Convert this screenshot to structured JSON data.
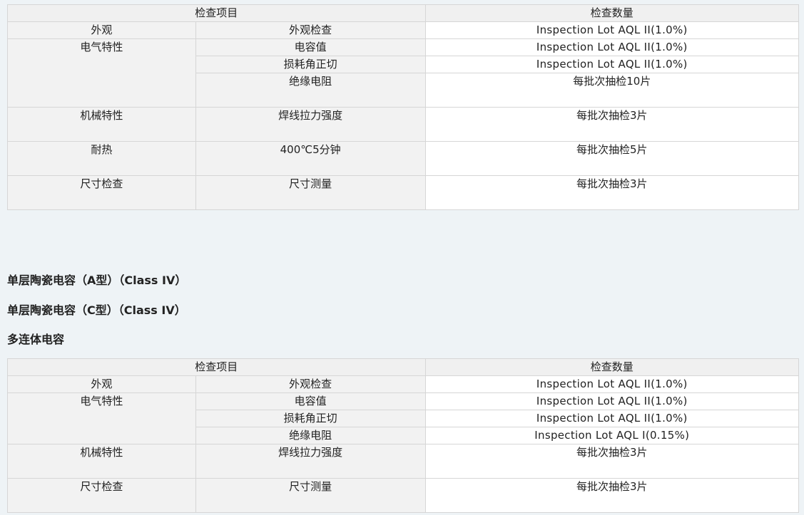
{
  "table1": {
    "header": {
      "item": "检查项目",
      "qty": "检查数量"
    },
    "rows": [
      {
        "cat": "外观",
        "sub": "外观检查",
        "qty": "Inspection Lot AQL II(1.0%)"
      },
      {
        "cat": "电气特性",
        "sub": "电容值",
        "qty": "Inspection Lot AQL II(1.0%)"
      },
      {
        "sub": "损耗角正切",
        "qty": "Inspection Lot AQL II(1.0%)"
      },
      {
        "sub": "绝缘电阻",
        "qty": "每批次抽检10片"
      },
      {
        "cat": "机械特性",
        "sub": "焊线拉力强度",
        "qty": "每批次抽检3片"
      },
      {
        "cat": "耐热",
        "sub": "400℃5分钟",
        "qty": "每批次抽检5片"
      },
      {
        "cat": "尺寸检查",
        "sub": "尺寸测量",
        "qty": "每批次抽检3片"
      }
    ]
  },
  "headings": [
    "单层陶瓷电容（A型）（Class IV）",
    "单层陶瓷电容（C型）（Class IV）",
    "多连体电容"
  ],
  "table2": {
    "header": {
      "item": "检查项目",
      "qty": "检查数量"
    },
    "rows": [
      {
        "cat": "外观",
        "sub": "外观检查",
        "qty": "Inspection Lot AQL II(1.0%)"
      },
      {
        "cat": "电气特性",
        "sub": "电容值",
        "qty": "Inspection Lot AQL II(1.0%)"
      },
      {
        "sub": "损耗角正切",
        "qty": "Inspection Lot AQL II(1.0%)"
      },
      {
        "sub": "绝缘电阻",
        "qty": "Inspection Lot AQL Ⅰ(0.15%)"
      },
      {
        "cat": "机械特性",
        "sub": "焊线拉力强度",
        "qty": "每批次抽检3片"
      },
      {
        "cat": "尺寸检查",
        "sub": "尺寸测量",
        "qty": "每批次抽检3片"
      }
    ]
  }
}
